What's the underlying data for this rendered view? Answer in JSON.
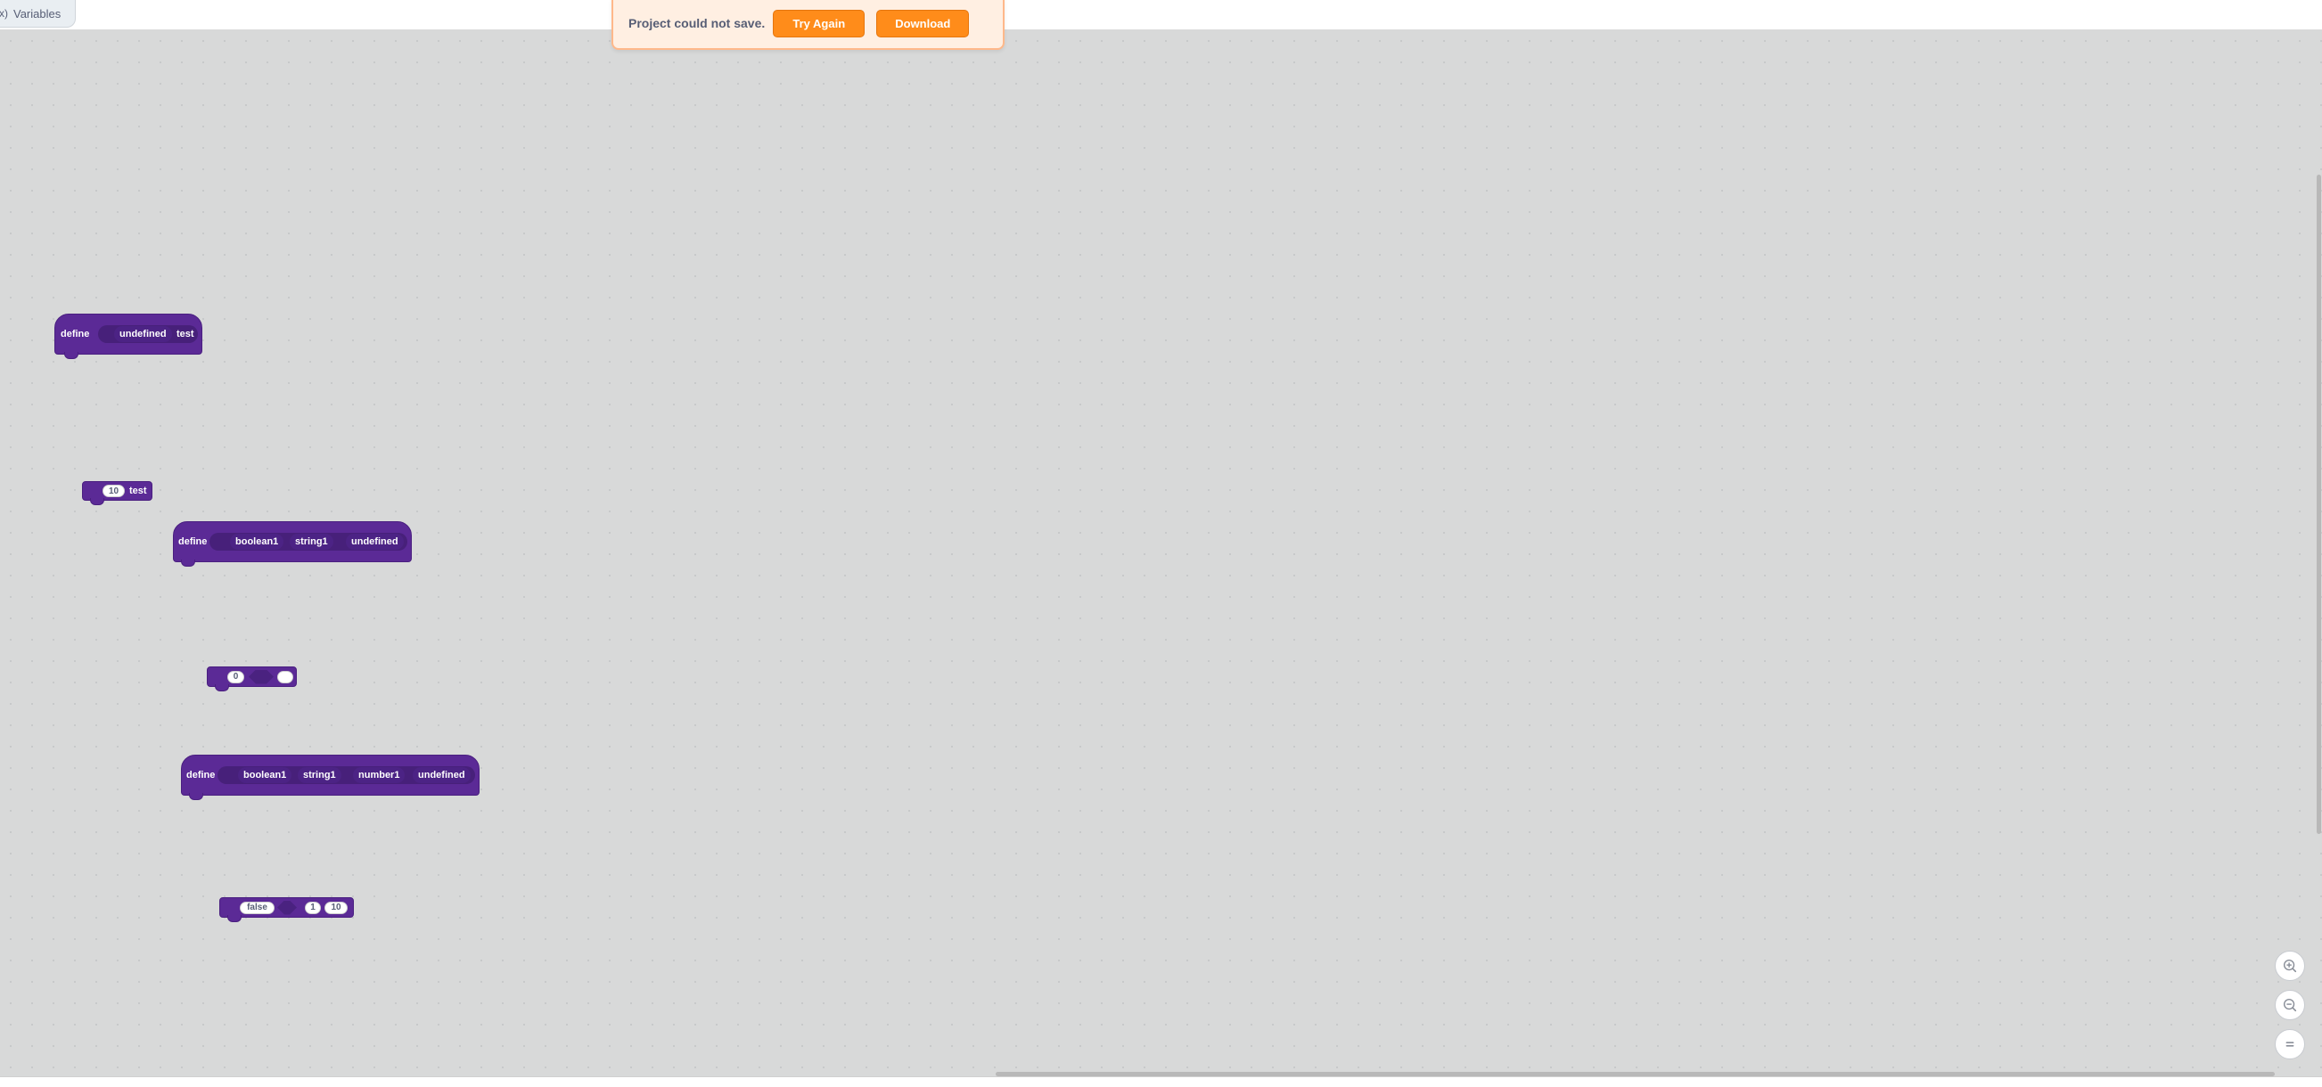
{
  "tab": {
    "label": "Variables",
    "icon": "variables-icon"
  },
  "alert": {
    "message": "Project could not save.",
    "try_again": "Try Again",
    "download": "Download"
  },
  "blocks": {
    "define1": {
      "keyword": "define",
      "arg1": "undefined",
      "arg2": "test"
    },
    "call1": {
      "value": "10",
      "label": "test"
    },
    "define2": {
      "keyword": "define",
      "arg1": "boolean1",
      "arg2": "string1",
      "arg3": "undefined"
    },
    "call2": {
      "value": "0",
      "value2": ""
    },
    "define3": {
      "keyword": "define",
      "arg1": "boolean1",
      "arg2": "string1",
      "arg3": "number1",
      "arg4": "undefined"
    },
    "call3": {
      "value1": "false",
      "value2": "1",
      "value3": "10"
    }
  },
  "zoom": {
    "in_icon": "zoom-in-icon",
    "out_icon": "zoom-out-icon",
    "reset_icon": "zoom-reset-icon"
  },
  "colors": {
    "block": "#5b2a96",
    "alert_btn": "#ff8c1a",
    "workspace": "#d8d9d9"
  }
}
